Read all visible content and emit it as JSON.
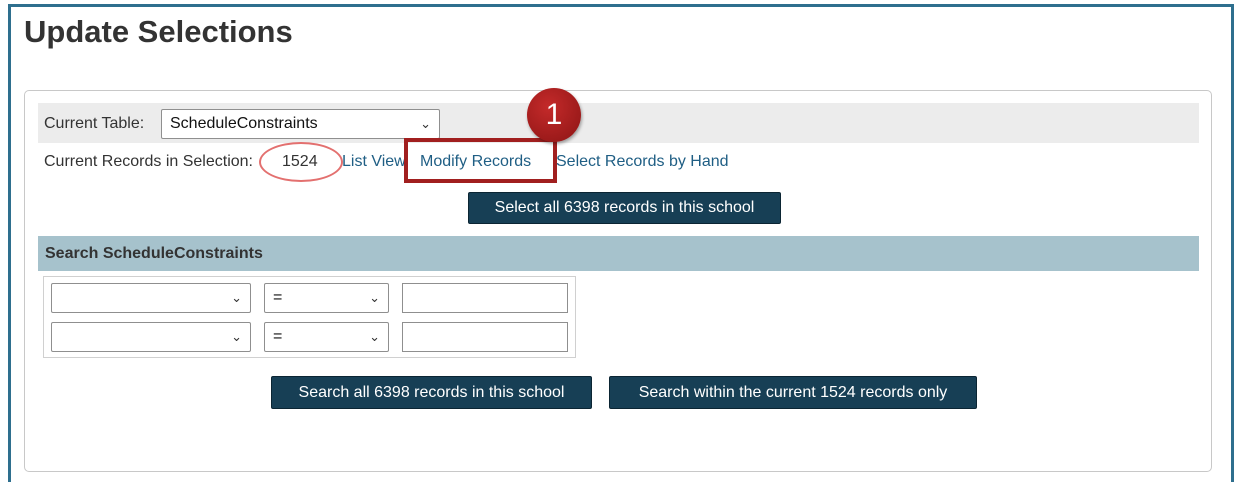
{
  "page": {
    "title": "Update Selections"
  },
  "current_table": {
    "label": "Current Table:",
    "selected": "ScheduleConstraints"
  },
  "records": {
    "label": "Current Records in Selection:",
    "count": "1524",
    "links": {
      "list_view": "List View",
      "modify_records": "Modify Records",
      "select_by_hand": "Select Records by Hand"
    }
  },
  "select_all_button": "Select all 6398 records in this school",
  "search": {
    "header": "Search ScheduleConstraints",
    "rows": [
      {
        "field": "",
        "operator": "=",
        "value": ""
      },
      {
        "field": "",
        "operator": "=",
        "value": ""
      }
    ],
    "search_all_button": "Search all 6398 records in this school",
    "search_within_button": "Search within the current 1524 records only"
  },
  "annotation": {
    "step": "1"
  },
  "icons": {
    "dropdown": "chevron-down-icon"
  },
  "colors": {
    "button_bg": "#173f55",
    "link": "#1f5e84",
    "search_header_bg": "#a6c2cc",
    "annotation_red": "#a11f1f",
    "frame_border": "#2e6f8e"
  }
}
